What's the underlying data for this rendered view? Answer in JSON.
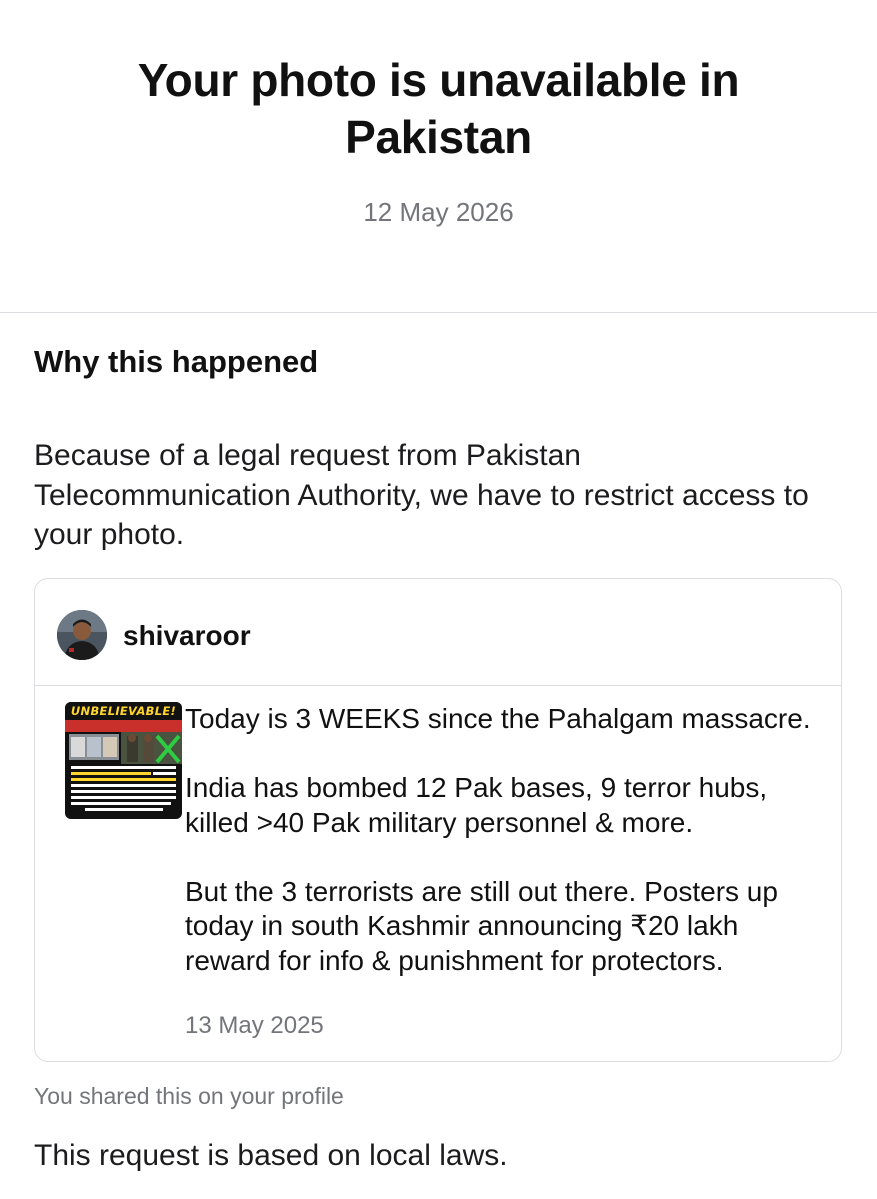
{
  "header": {
    "title": "Your photo is unavailable in Pakistan",
    "date": "12 May 2026"
  },
  "why": {
    "heading": "Why this happened",
    "body": "Because of a legal request from Pakistan Telecommunication Authority, we have to restrict access to your photo."
  },
  "post": {
    "username": "shivaroor",
    "avatar_icon": "profile-photo",
    "thumbnail_banner": "UNBELIEVABLE!",
    "thumbnail_icon": "news-graphic-thumbnail",
    "paragraphs": [
      "Today is 3 WEEKS since the Pahalgam massacre.",
      "India has bombed 12 Pak bases, 9 terror hubs, killed >40 Pak military personnel & more.",
      "But the 3 terrorists are still out there. Posters up today in south Kashmir announcing ₹20 lakh reward for info & punishment for protectors."
    ],
    "date": "13 May 2025"
  },
  "footer": {
    "shared_note": "You shared this on your profile",
    "local_laws": "This request is based on local laws."
  },
  "colors": {
    "text": "#111111",
    "secondary_text": "#73757a",
    "border": "#dcdde0",
    "background": "#ffffff"
  }
}
